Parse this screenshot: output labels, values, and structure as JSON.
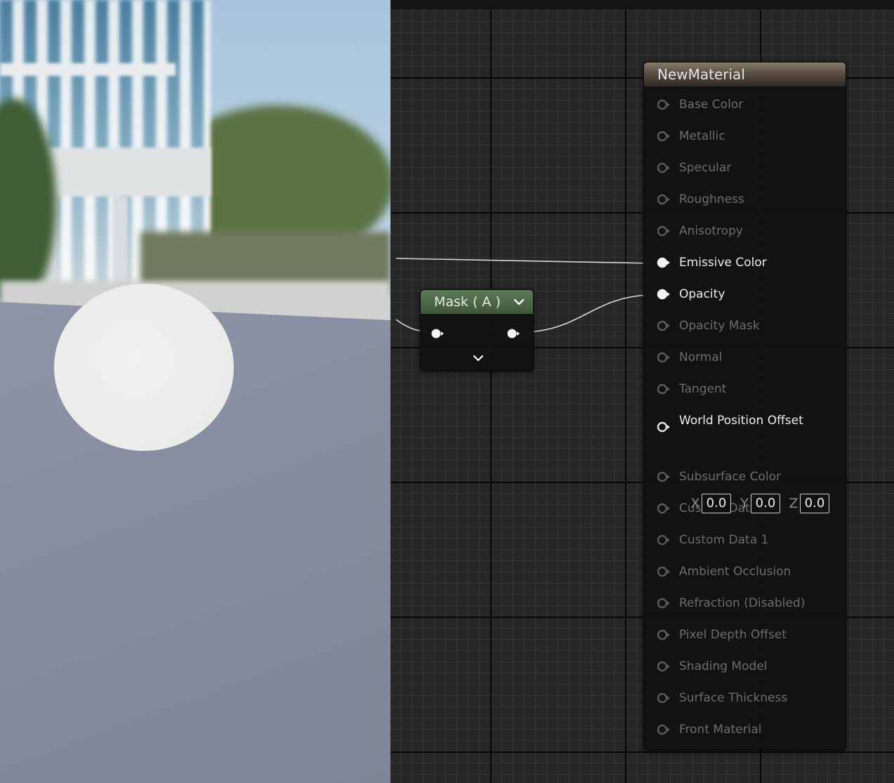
{
  "graph": {
    "mask_node": {
      "title": "Mask ( A )"
    },
    "material_node": {
      "title": "NewMaterial",
      "inputs": [
        {
          "label": "Base Color",
          "connected": false
        },
        {
          "label": "Metallic",
          "connected": false
        },
        {
          "label": "Specular",
          "connected": false
        },
        {
          "label": "Roughness",
          "connected": false
        },
        {
          "label": "Anisotropy",
          "connected": false
        },
        {
          "label": "Emissive Color",
          "connected": true
        },
        {
          "label": "Opacity",
          "connected": true
        },
        {
          "label": "Opacity Mask",
          "connected": false
        },
        {
          "label": "Normal",
          "connected": false
        },
        {
          "label": "Tangent",
          "connected": false
        },
        {
          "label": "World Position Offset",
          "connected": false
        },
        {
          "label": "Subsurface Color",
          "connected": false
        },
        {
          "label": "Custom Data 0",
          "connected": false
        },
        {
          "label": "Custom Data 1",
          "connected": false
        },
        {
          "label": "Ambient Occlusion",
          "connected": false
        },
        {
          "label": "Refraction (Disabled)",
          "connected": false
        },
        {
          "label": "Pixel Depth Offset",
          "connected": false
        },
        {
          "label": "Shading Model",
          "connected": false
        },
        {
          "label": "Surface Thickness",
          "connected": false
        },
        {
          "label": "Front Material",
          "connected": false
        }
      ],
      "wpo": {
        "x_label": "X",
        "x_value": "0.0",
        "y_label": "Y",
        "y_value": "0.0",
        "z_label": "Z",
        "z_value": "0.0"
      }
    }
  },
  "colors": {
    "graph_bg": "#262626",
    "mask_header": "#4f6a48",
    "material_header": "#6e6255",
    "active_text": "#ededed",
    "inactive_text": "#6d6d6d"
  },
  "icons": {
    "pin_connected": "filled-circle-pin-icon",
    "pin_unconnected": "hollow-circle-pin-icon",
    "chevron": "chevron-down-icon"
  }
}
